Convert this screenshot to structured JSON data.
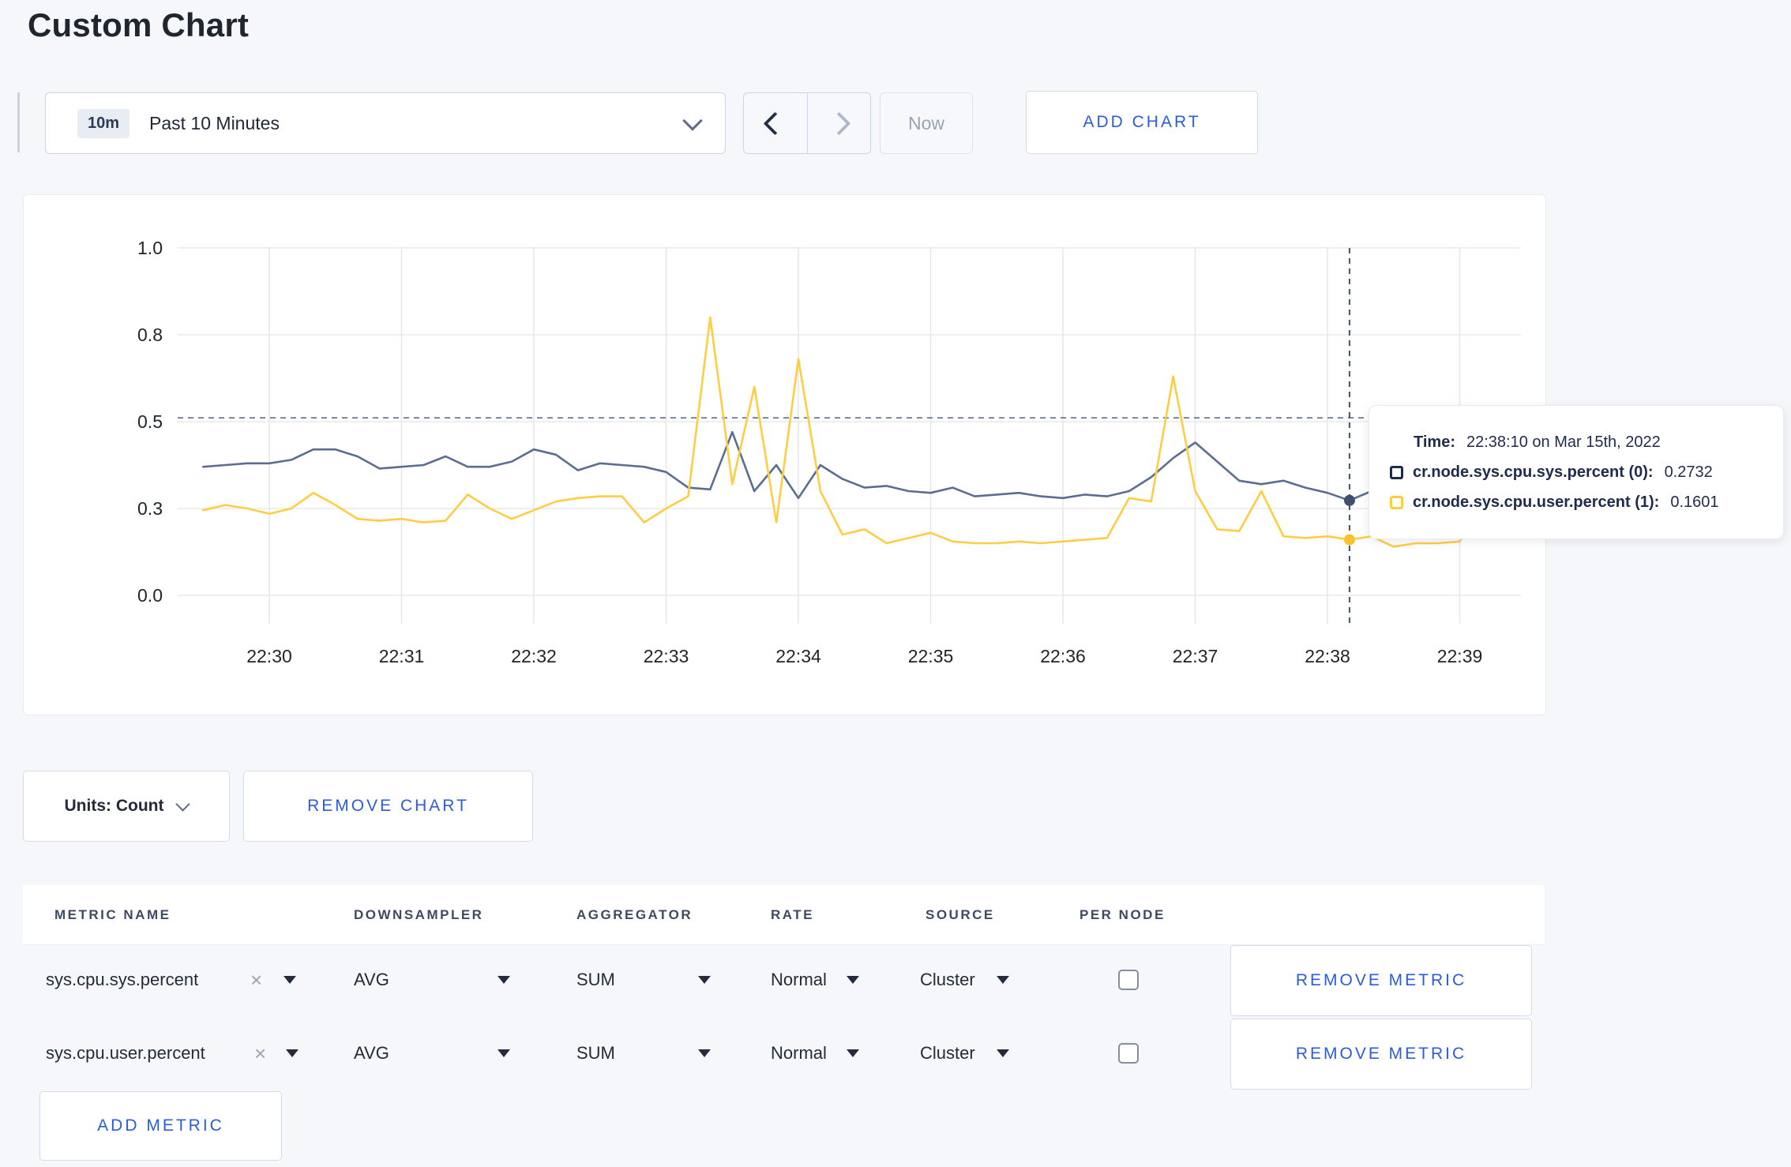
{
  "page": {
    "title": "Custom Chart"
  },
  "toolbar": {
    "time_range_badge": "10m",
    "time_range_label": "Past 10 Minutes",
    "now_label": "Now",
    "add_chart_label": "ADD CHART"
  },
  "chart_data": {
    "type": "line",
    "title": "",
    "xlabel": "",
    "ylabel": "",
    "ylim": [
      0,
      1
    ],
    "grid": true,
    "legend_position": "tooltip",
    "x_ticks": [
      "22:30",
      "22:31",
      "22:32",
      "22:33",
      "22:34",
      "22:35",
      "22:36",
      "22:37",
      "22:38",
      "22:39"
    ],
    "y_ticks": [
      {
        "label": "1.0",
        "value": 1.0
      },
      {
        "label": "0.8",
        "value": 0.75
      },
      {
        "label": "0.5",
        "value": 0.5
      },
      {
        "label": "0.3",
        "value": 0.25
      },
      {
        "label": "0.0",
        "value": 0.0
      }
    ],
    "start_time": "22:29:30",
    "step_seconds": 10,
    "series": [
      {
        "name": "cr.node.sys.cpu.sys.percent (0)",
        "color": "#5b6e8f",
        "dot_color": "#3f4f6e",
        "values": [
          0.37,
          0.375,
          0.38,
          0.38,
          0.39,
          0.42,
          0.42,
          0.4,
          0.365,
          0.37,
          0.375,
          0.4,
          0.37,
          0.37,
          0.385,
          0.42,
          0.405,
          0.36,
          0.38,
          0.375,
          0.37,
          0.355,
          0.31,
          0.305,
          0.47,
          0.3,
          0.375,
          0.28,
          0.375,
          0.335,
          0.31,
          0.315,
          0.3,
          0.295,
          0.31,
          0.285,
          0.29,
          0.295,
          0.285,
          0.28,
          0.29,
          0.285,
          0.3,
          0.34,
          0.395,
          0.44,
          0.385,
          0.33,
          0.32,
          0.33,
          0.31,
          0.295,
          0.2732,
          0.3,
          0.31,
          0.295,
          0.32,
          0.3,
          0.31,
          0.3
        ]
      },
      {
        "name": "cr.node.sys.cpu.user.percent (1)",
        "color": "#ffcd44",
        "dot_color": "#fdc12e",
        "values": [
          0.245,
          0.26,
          0.25,
          0.235,
          0.25,
          0.295,
          0.26,
          0.22,
          0.215,
          0.22,
          0.21,
          0.215,
          0.29,
          0.25,
          0.22,
          0.245,
          0.27,
          0.28,
          0.285,
          0.285,
          0.21,
          0.25,
          0.285,
          0.8,
          0.32,
          0.6,
          0.21,
          0.68,
          0.3,
          0.175,
          0.19,
          0.15,
          0.165,
          0.18,
          0.155,
          0.15,
          0.15,
          0.155,
          0.15,
          0.155,
          0.16,
          0.165,
          0.28,
          0.27,
          0.63,
          0.3,
          0.19,
          0.185,
          0.3,
          0.17,
          0.165,
          0.17,
          0.1601,
          0.17,
          0.14,
          0.15,
          0.15,
          0.155,
          0.28,
          0.24
        ]
      }
    ],
    "crosshair": {
      "time": "22:38:10",
      "minutes_after_first_tick": 8.1667,
      "h_line_value": 0.511,
      "point_values": [
        0.2732,
        0.1601
      ]
    }
  },
  "tooltip": {
    "time_label": "Time:",
    "time_value": "22:38:10 on Mar 15th, 2022",
    "rows": [
      {
        "label": "cr.node.sys.cpu.sys.percent (0):",
        "value": "0.2732",
        "swatch_color": "#1c2b4a"
      },
      {
        "label": "cr.node.sys.cpu.user.percent (1):",
        "value": "0.1601",
        "swatch_color": "#ffcd44"
      }
    ]
  },
  "chart_controls": {
    "units_label": "Units: Count",
    "remove_chart_label": "REMOVE CHART"
  },
  "metrics_table": {
    "headers": [
      "METRIC NAME",
      "DOWNSAMPLER",
      "AGGREGATOR",
      "RATE",
      "SOURCE",
      "PER NODE"
    ],
    "rows": [
      {
        "metric": "sys.cpu.sys.percent",
        "downsampler": "AVG",
        "aggregator": "SUM",
        "rate": "Normal",
        "source": "Cluster",
        "per_node_checked": false,
        "remove_label": "REMOVE METRIC"
      },
      {
        "metric": "sys.cpu.user.percent",
        "downsampler": "AVG",
        "aggregator": "SUM",
        "rate": "Normal",
        "source": "Cluster",
        "per_node_checked": false,
        "remove_label": "REMOVE METRIC"
      }
    ],
    "add_metric_label": "ADD METRIC"
  },
  "icons": {
    "metric_remove": "×"
  },
  "colors": {
    "accent_blue": "#2b5cdc",
    "series_sys": "#5b6e8f",
    "series_user": "#ffcd44",
    "background": "#f5f7fa"
  }
}
